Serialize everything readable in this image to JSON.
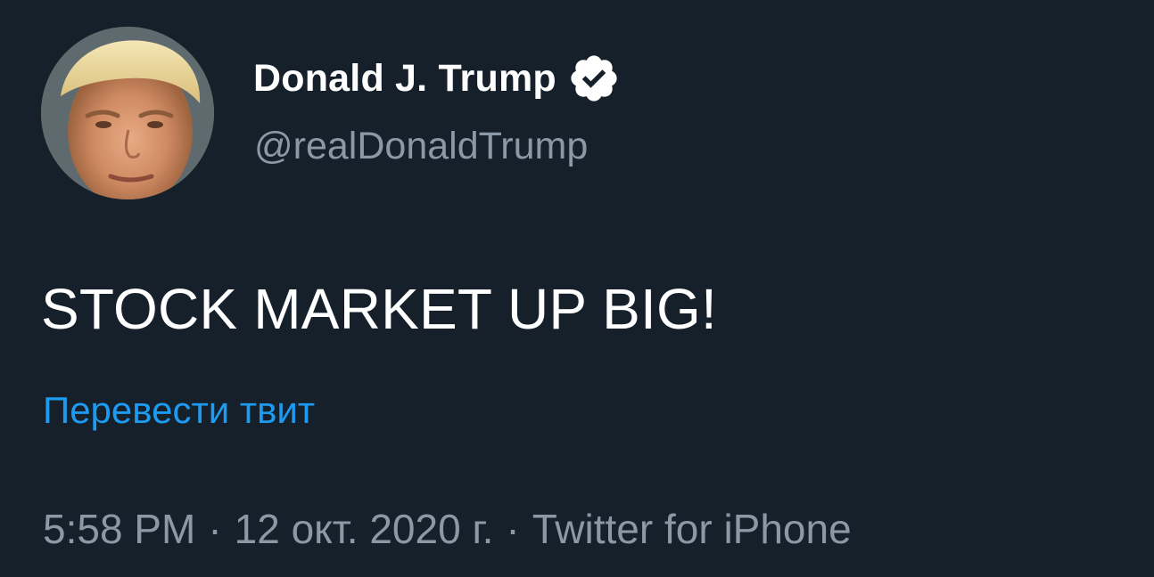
{
  "author": {
    "display_name": "Donald J. Trump",
    "handle": "@realDonaldTrump",
    "verified": true
  },
  "tweet": {
    "text": "STOCK MARKET UP BIG!",
    "translate_label": "Перевести твит",
    "time": "5:58 PM",
    "date": "12 окт. 2020 г.",
    "separator": "·",
    "source": "Twitter for iPhone"
  },
  "colors": {
    "background": "#15202b",
    "primary_text": "#ffffff",
    "secondary_text": "#8b98a5",
    "link": "#1d9bf0"
  },
  "icons": {
    "verified_badge": "verified-badge-icon",
    "avatar": "profile-photo"
  }
}
